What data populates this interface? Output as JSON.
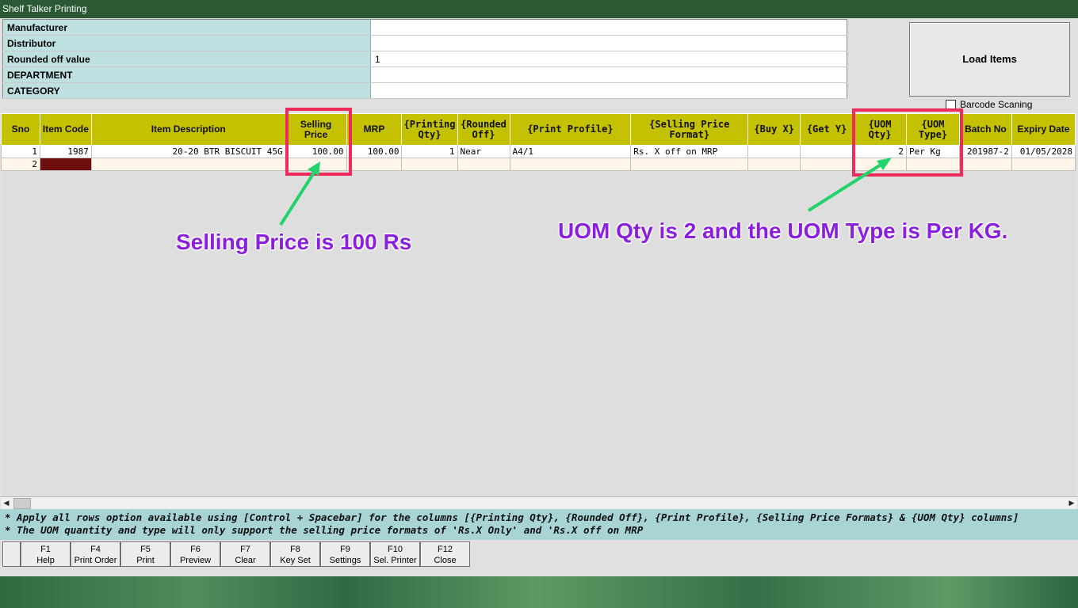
{
  "window": {
    "title": "Shelf Talker Printing"
  },
  "filters": [
    {
      "label": "Manufacturer",
      "value": ""
    },
    {
      "label": "Distributor",
      "value": ""
    },
    {
      "label": "Rounded off value",
      "value": "1"
    },
    {
      "label": "DEPARTMENT",
      "value": ""
    },
    {
      "label": "CATEGORY",
      "value": ""
    }
  ],
  "load_button": {
    "label": "Load Items"
  },
  "barcode": {
    "label": "Barcode Scaning",
    "checked": false
  },
  "grid": {
    "headers": [
      "Sno",
      "Item Code",
      "Item Description",
      "Selling Price",
      "MRP",
      "{Printing Qty}",
      "{Rounded Off}",
      "{Print Profile}",
      "{Selling Price Format}",
      "{Buy X}",
      "{Get Y}",
      "{UOM Qty}",
      "{UOM Type}",
      "Batch No",
      "Expiry Date"
    ],
    "rows": [
      [
        "1",
        "1987",
        "20-20 BTR BISCUIT 45G",
        "100.00",
        "100.00",
        "1",
        "Near",
        "A4/1",
        "Rs. X off on MRP",
        "",
        "",
        "2",
        "Per Kg",
        "201987-2",
        "01/05/2028"
      ],
      [
        "2",
        "",
        "",
        "",
        "",
        "",
        "",
        "",
        "",
        "",
        "",
        "",
        "",
        "",
        ""
      ]
    ]
  },
  "notes": [
    "* Apply all rows option available using [Control + Spacebar] for the columns [{Printing Qty}, {Rounded Off}, {Print Profile}, {Selling Price Formats} & {UOM Qty} columns]",
    "* The UOM quantity and type will only support the selling price formats of 'Rs.X Only' and 'Rs.X off on MRP"
  ],
  "function_keys": [
    {
      "key": "F1",
      "label": "Help"
    },
    {
      "key": "F4",
      "label": "Print Order"
    },
    {
      "key": "F5",
      "label": "Print"
    },
    {
      "key": "F6",
      "label": "Preview"
    },
    {
      "key": "F7",
      "label": "Clear"
    },
    {
      "key": "F8",
      "label": "Key Set"
    },
    {
      "key": "F9",
      "label": "Settings"
    },
    {
      "key": "F10",
      "label": "Sel. Printer"
    },
    {
      "key": "F12",
      "label": "Close"
    }
  ],
  "annotations": {
    "selling_price": "Selling Price is 100 Rs",
    "uom": "UOM Qty is 2 and the UOM Type is Per KG.",
    "color": "#8a1fe0",
    "highlight_color": "#ef2a5c"
  },
  "colors": {
    "header": "#c3c100",
    "filter_label": "#bfe0e1",
    "titlebar": "#2a5934",
    "notes": "#a8d4d6"
  }
}
